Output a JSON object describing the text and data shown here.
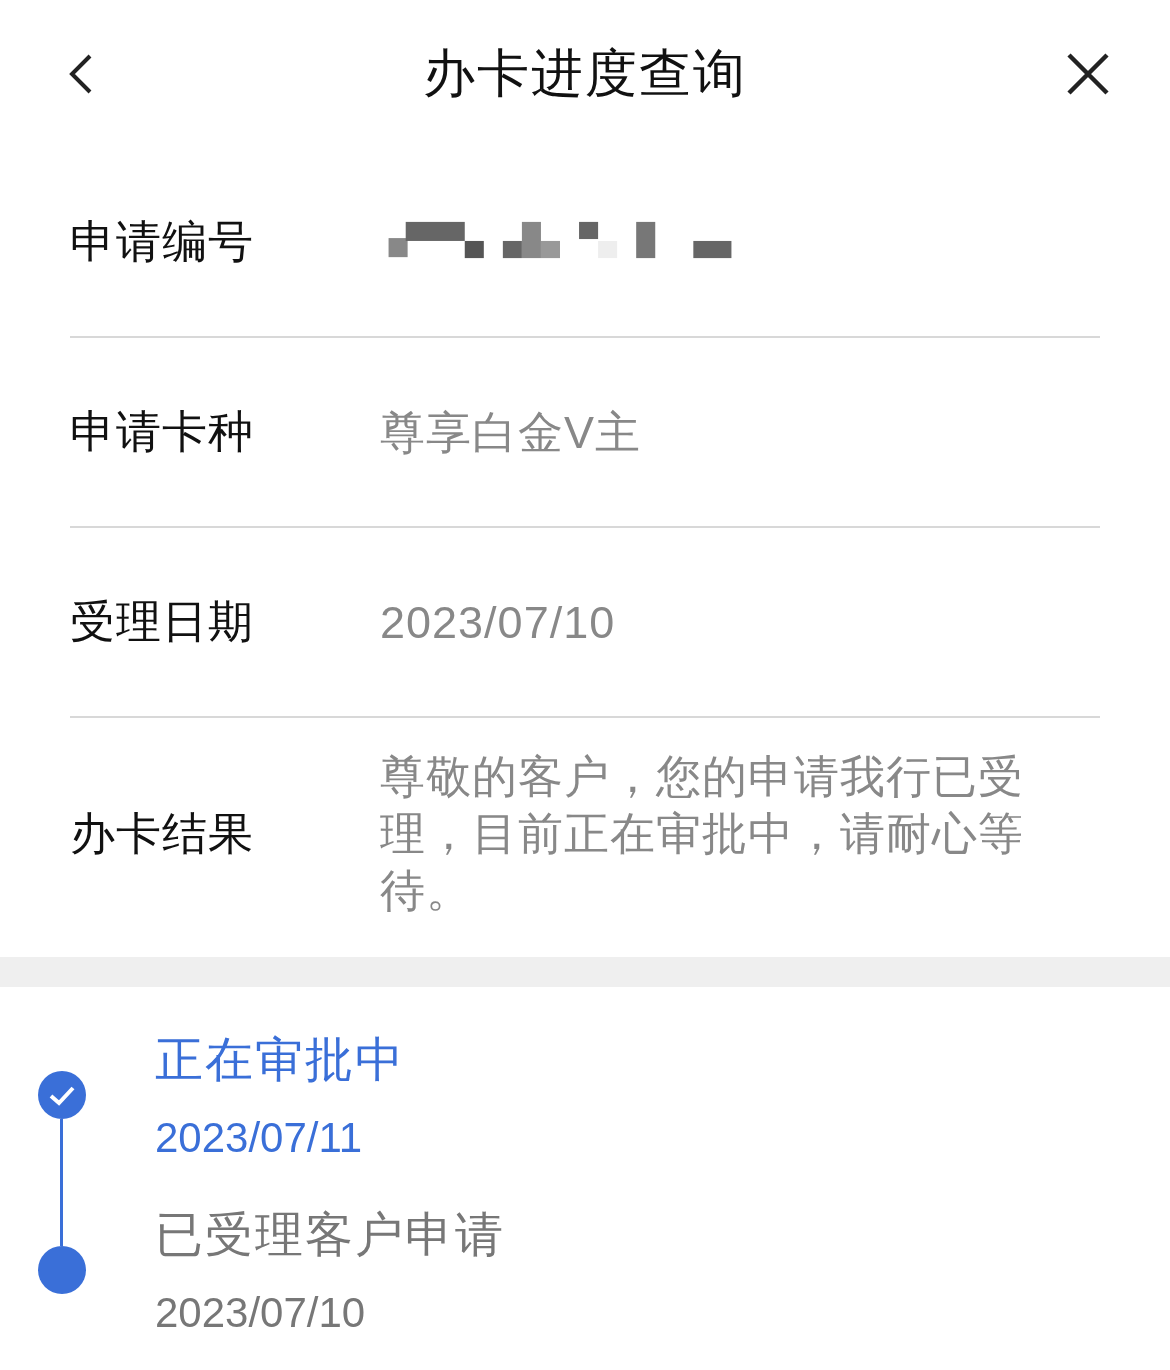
{
  "header": {
    "title": "办卡进度查询"
  },
  "rows": [
    {
      "label": "申请编号",
      "kind": "redacted"
    },
    {
      "label": "申请卡种",
      "kind": "text",
      "value": "尊享白金V主"
    },
    {
      "label": "受理日期",
      "kind": "text",
      "value": "2023/07/10"
    },
    {
      "label": "办卡结果",
      "kind": "text",
      "value": "尊敬的客户，您的申请我行已受理，目前正在审批中，请耐心等待。"
    }
  ],
  "timeline": [
    {
      "title": "正在审批中",
      "date": "2023/07/11",
      "current": true
    },
    {
      "title": "已受理客户申请",
      "date": "2023/07/10",
      "current": false
    }
  ]
}
